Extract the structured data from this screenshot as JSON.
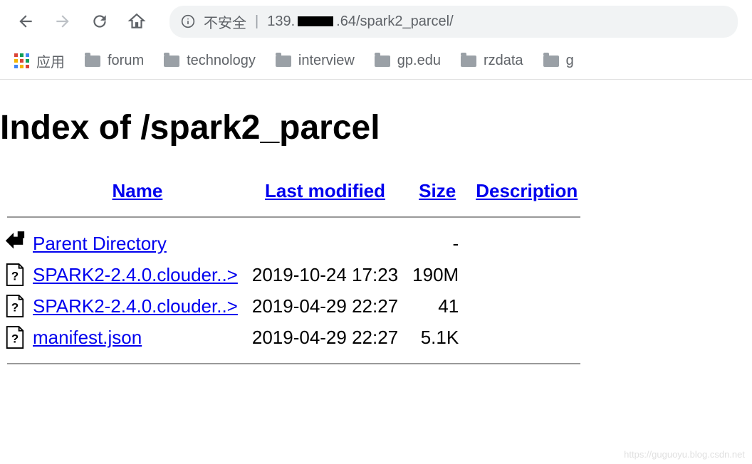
{
  "toolbar": {
    "insecure_label": "不安全",
    "url_prefix": "139.",
    "url_suffix": ".64/spark2_parcel/"
  },
  "bookmarks": {
    "apps_label": "应用",
    "items": [
      "forum",
      "technology",
      "interview",
      "gp.edu",
      "rzdata",
      "g"
    ]
  },
  "page": {
    "heading": "Index of /spark2_parcel",
    "columns": {
      "name": "Name",
      "modified": "Last modified",
      "size": "Size",
      "description": "Description"
    },
    "rows": [
      {
        "icon": "back",
        "name": "Parent Directory",
        "modified": "",
        "size": "-"
      },
      {
        "icon": "unknown",
        "name": "SPARK2-2.4.0.clouder..>",
        "modified": "2019-10-24 17:23",
        "size": "190M"
      },
      {
        "icon": "unknown",
        "name": "SPARK2-2.4.0.clouder..>",
        "modified": "2019-04-29 22:27",
        "size": "41"
      },
      {
        "icon": "unknown",
        "name": "manifest.json",
        "modified": "2019-04-29 22:27",
        "size": "5.1K"
      }
    ]
  },
  "watermark": "https://guguoyu.blog.csdn.net"
}
